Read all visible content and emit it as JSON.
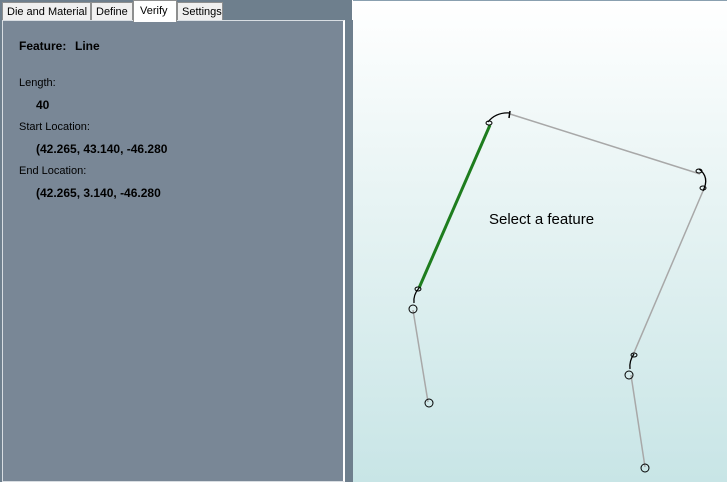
{
  "tabs": [
    {
      "label": "Die and Material",
      "active": false
    },
    {
      "label": "Define",
      "active": false
    },
    {
      "label": "Verify",
      "active": true
    },
    {
      "label": "Settings",
      "active": false
    }
  ],
  "verify_panel": {
    "feature_label": "Feature:",
    "feature_value": "Line",
    "length_label": "Length:",
    "length_value": "40",
    "start_label": "Start Location:",
    "start_value": "(42.265, 43.140, -46.280",
    "end_label": "End Location:",
    "end_value": "(42.265, 3.140, -46.280"
  },
  "viewport": {
    "prompt": "Select a feature",
    "highlight_color": "#1e7d1e",
    "segment_color": "#a8a8a8"
  }
}
